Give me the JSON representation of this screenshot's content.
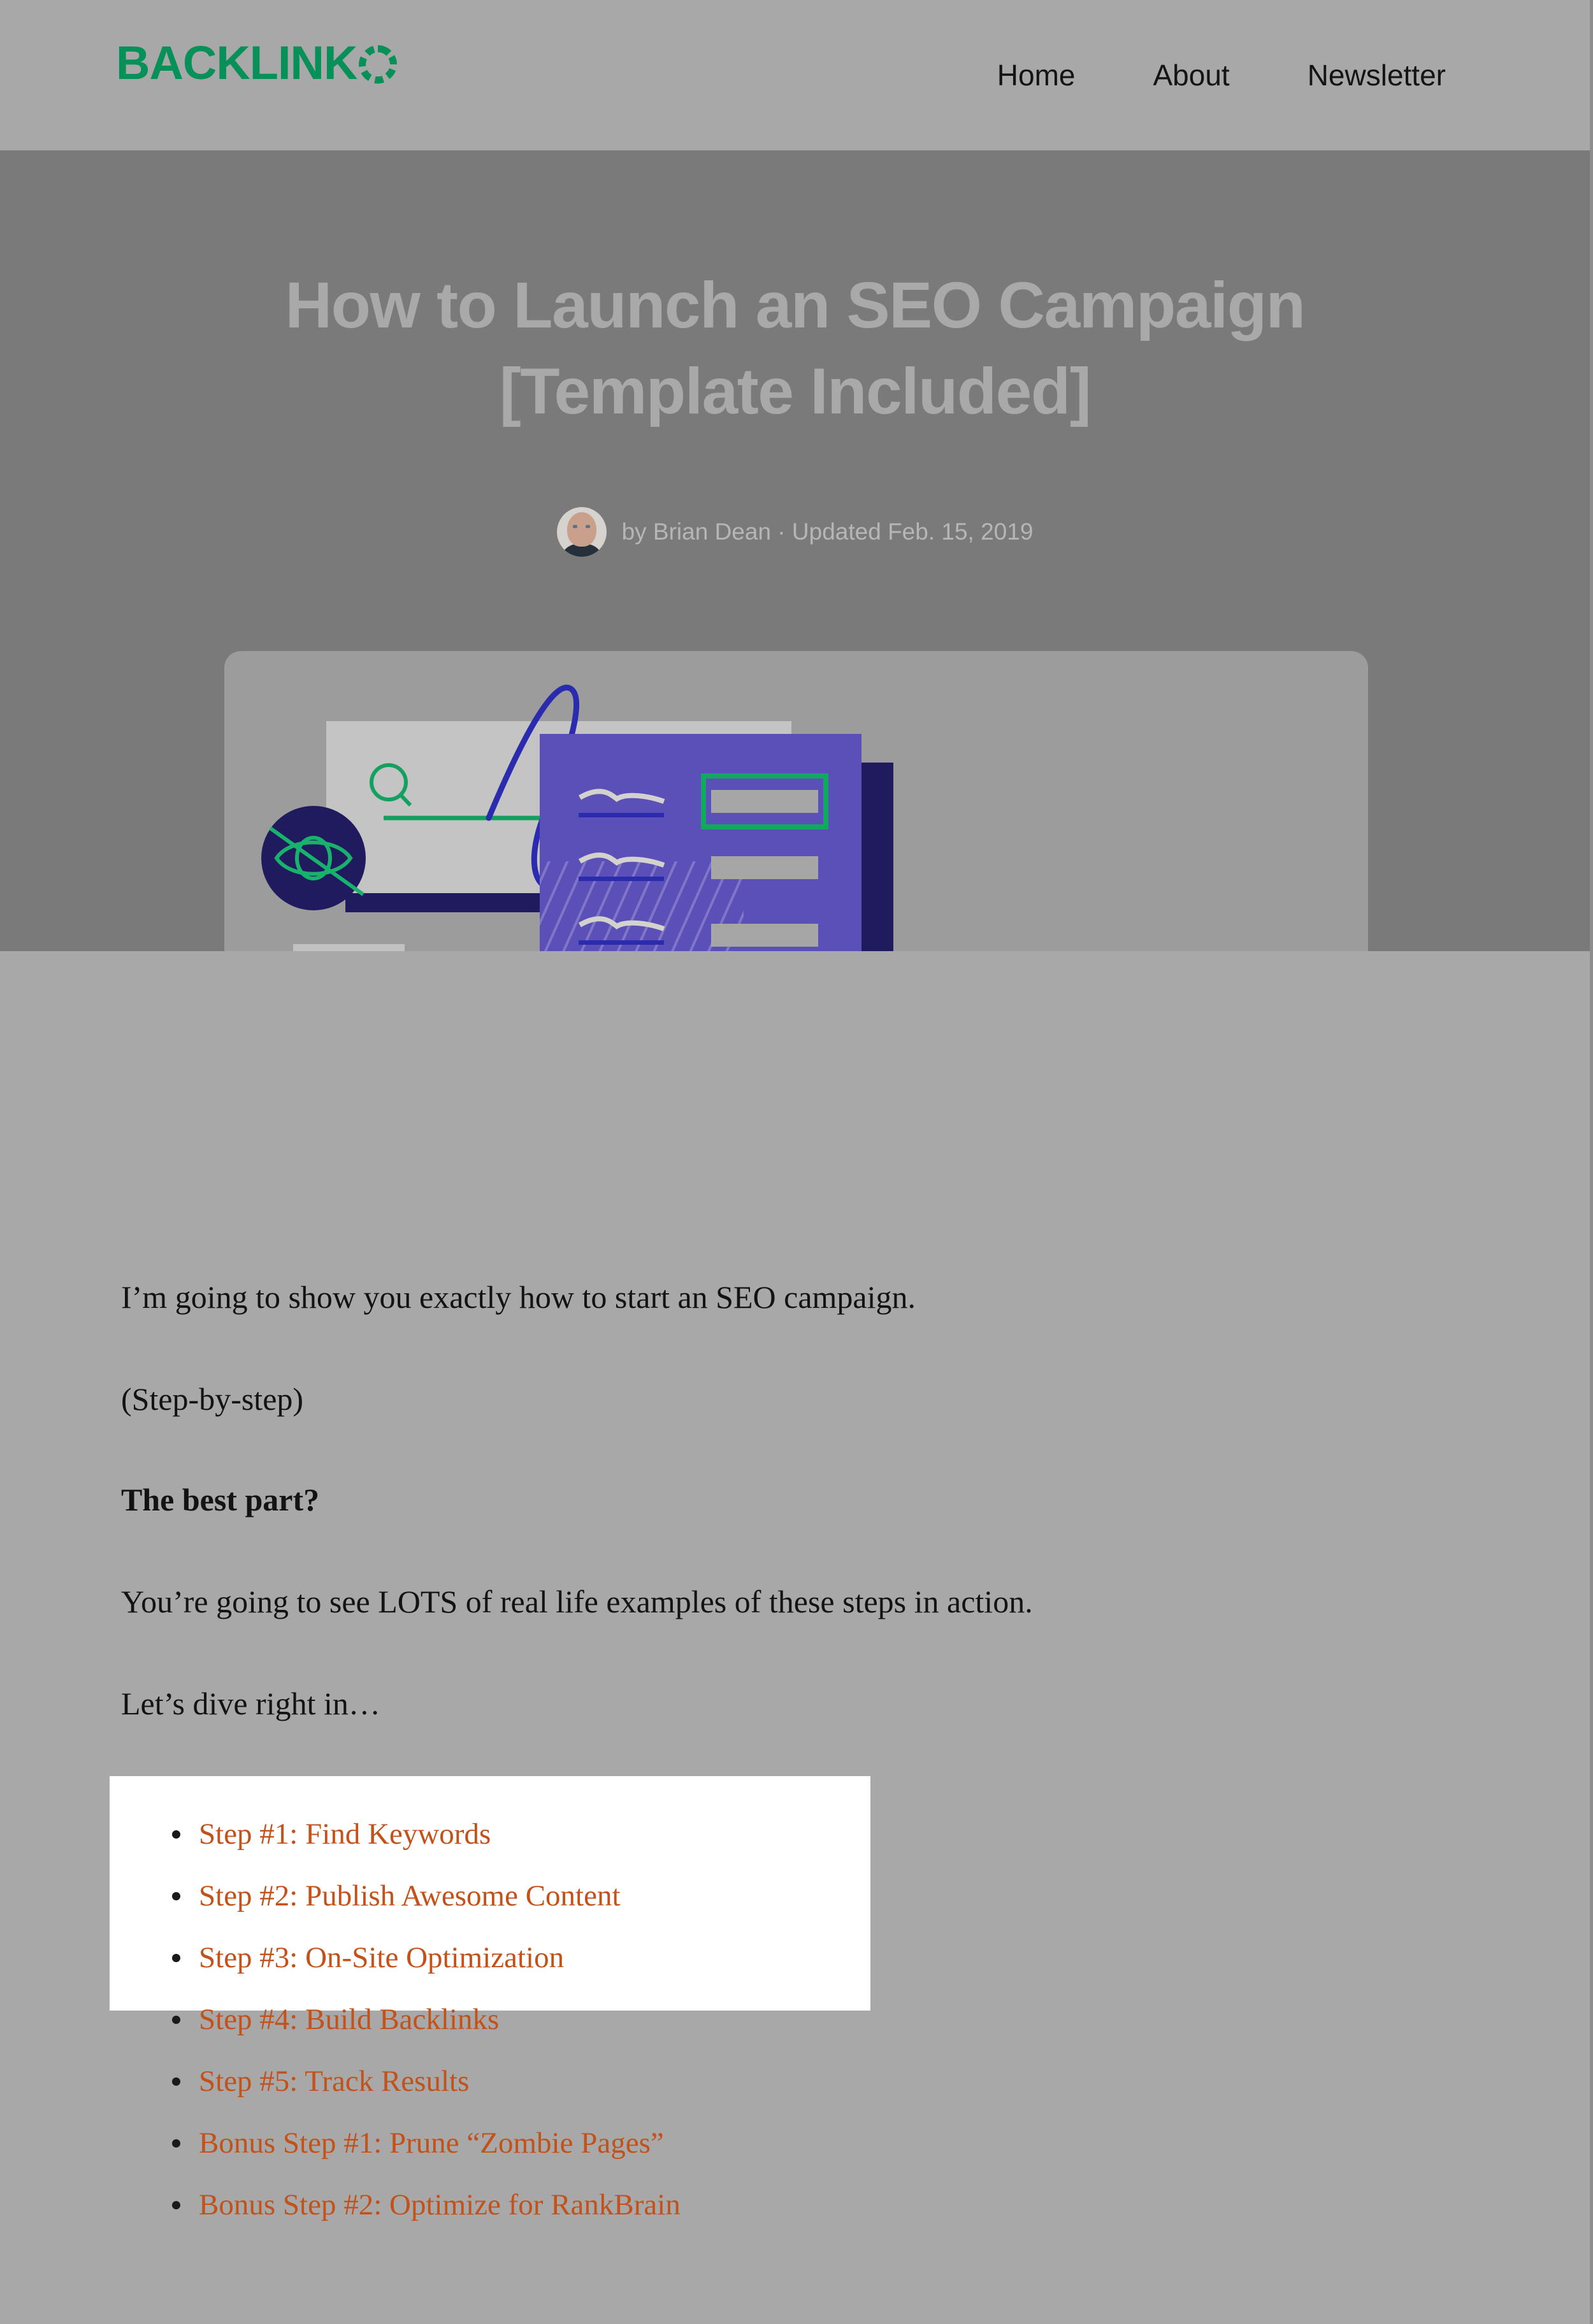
{
  "header": {
    "logo": {
      "wordmark": "BACKLINK",
      "mark_icon": "segmented-ring-icon",
      "color": "#079159"
    },
    "nav": [
      {
        "label": "Home"
      },
      {
        "label": "About"
      },
      {
        "label": "Newsletter"
      }
    ]
  },
  "hero": {
    "title_line1": "How to Launch an SEO Campaign",
    "title_line2": "[Template Included]",
    "byline": "by Brian Dean · Updated Feb. 15, 2019",
    "author": "Brian Dean",
    "updated": "Updated Feb. 15, 2019",
    "avatar_alt": "author-avatar"
  },
  "figure": {
    "alt": "seo-campaign-illustration",
    "colors": {
      "navy": "#201b5e",
      "purple": "#5b50b8",
      "green": "#14a05f",
      "blue": "#2b2bb0",
      "light": "#c8c8c8",
      "panel_bg": "#9c9c9c"
    }
  },
  "article": {
    "paragraphs": [
      {
        "text": "I’m going to show you exactly how to start an SEO campaign.",
        "bold": false
      },
      {
        "text": "(Step-by-step)",
        "bold": false
      },
      {
        "text": "The best part?",
        "bold": true
      },
      {
        "text": "You’re going to see LOTS of real life examples of these steps in action.",
        "bold": false
      },
      {
        "text": "Let’s dive right in…",
        "bold": false
      }
    ]
  },
  "toc": {
    "link_color": "#c2511a",
    "items": [
      {
        "label": "Step #1: Find Keywords"
      },
      {
        "label": "Step #2: Publish Awesome Content"
      },
      {
        "label": "Step #3: On-Site Optimization"
      },
      {
        "label": "Step #4: Build Backlinks"
      },
      {
        "label": "Step #5: Track Results"
      },
      {
        "label": "Bonus Step #1: Prune “Zombie Pages”"
      },
      {
        "label": "Bonus Step #2: Optimize for RankBrain"
      }
    ]
  }
}
